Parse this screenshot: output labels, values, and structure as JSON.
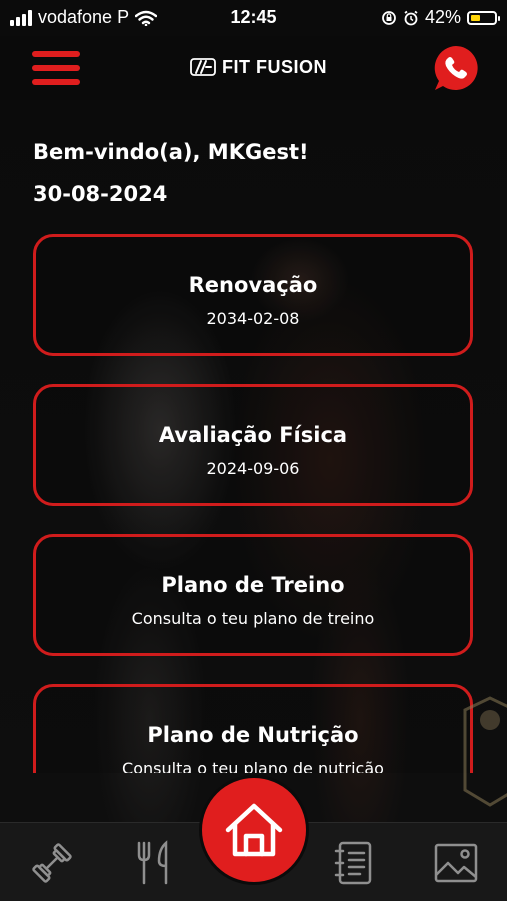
{
  "status_bar": {
    "carrier": "vodafone P",
    "time": "12:45",
    "battery_percent": "42%",
    "battery_level": 0.42,
    "icons": [
      "signal-icon",
      "wifi-icon",
      "rotation-lock-icon",
      "alarm-icon",
      "battery-icon"
    ]
  },
  "header": {
    "logo_text": "FIT FUSION",
    "menu_icon": "hamburger-icon",
    "contact_icon": "phone-icon"
  },
  "welcome": {
    "greeting": "Bem-vindo(a), MKGest!",
    "date": "30-08-2024"
  },
  "cards": [
    {
      "title": "Renovação",
      "subtitle": "2034-02-08"
    },
    {
      "title": "Avaliação Física",
      "subtitle": "2024-09-06"
    },
    {
      "title": "Plano de Treino",
      "subtitle": "Consulta o teu plano de treino"
    },
    {
      "title": "Plano de Nutrição",
      "subtitle": "Consulta o teu plano de nutrição"
    }
  ],
  "bottom_nav": {
    "items": [
      "dumbbell-icon",
      "fork-knife-icon",
      "home-icon",
      "notebook-icon",
      "gallery-icon"
    ],
    "active": "home-icon"
  },
  "colors": {
    "accent": "#e01e1e",
    "background": "#0b0b0b",
    "nav_background": "#181818"
  }
}
